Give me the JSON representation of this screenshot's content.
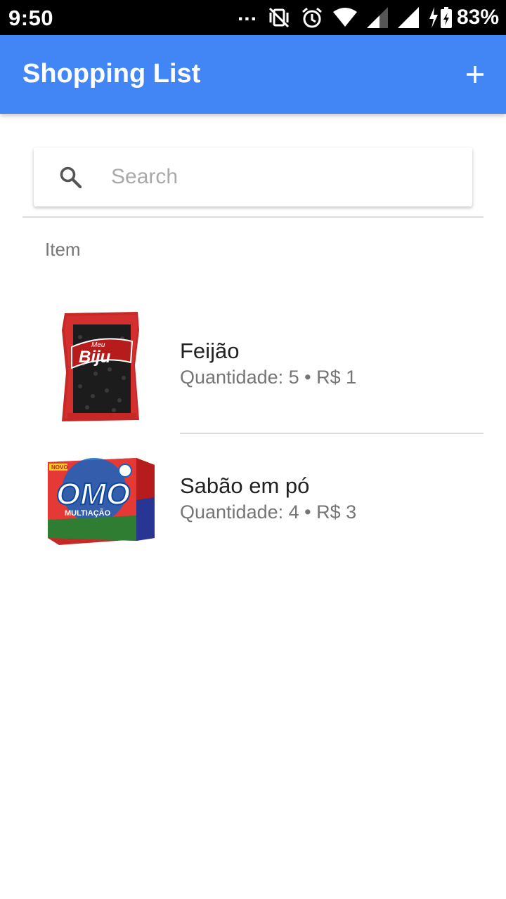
{
  "status_bar": {
    "time": "9:50",
    "dots": "...",
    "battery_percent": "83%",
    "icons": [
      "notifications-more-icon",
      "vibrate-off-icon",
      "alarm-icon",
      "wifi-icon",
      "signal-icon",
      "signal-icon",
      "battery-charging-icon"
    ]
  },
  "app_bar": {
    "title": "Shopping List",
    "add_icon": "plus-icon",
    "background": "#4285f4"
  },
  "search": {
    "placeholder": "Search",
    "value": "",
    "icon": "search-icon"
  },
  "list": {
    "header": "Item",
    "items": [
      {
        "name": "Feijão",
        "details": "Quantidade: 5 • R$ 1",
        "image": "feijao-package-image",
        "image_brand": "Biju",
        "image_brand_prefix": "Meu"
      },
      {
        "name": "Sabão em pó",
        "details": "Quantidade: 4 • R$ 3",
        "image": "omo-box-image",
        "image_brand": "OMO",
        "image_tag": "NOVO",
        "image_subtitle": "MULTIAÇÃO"
      }
    ]
  }
}
